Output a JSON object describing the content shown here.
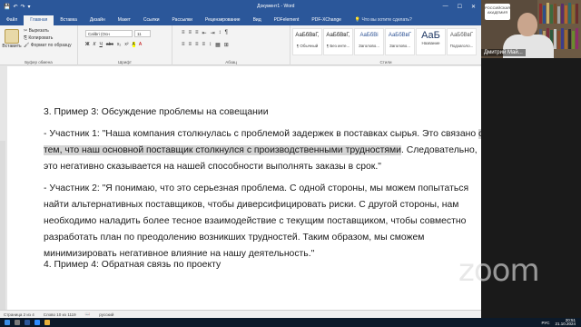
{
  "window": {
    "title": "Документ1 - Word",
    "qat": [
      "💾",
      "↶",
      "↷",
      "▾"
    ],
    "controls": [
      "—",
      "☐",
      "✕"
    ]
  },
  "ribbon_tabs": [
    "Файл",
    "Главная",
    "Вставка",
    "Дизайн",
    "Макет",
    "Ссылки",
    "Рассылки",
    "Рецензирование",
    "Вид",
    "PDFelement",
    "PDF-XChange"
  ],
  "tell_me": "Что вы хотите сделать?",
  "clipboard": {
    "paste_label": "Вставить",
    "cut": "Вырезать",
    "copy": "Копировать",
    "format_painter": "Формат по образцу",
    "group_label": "Буфер обмена"
  },
  "font": {
    "name": "Calibri (Осн",
    "size": "11",
    "format_buttons": [
      "Ж",
      "К",
      "Ч",
      "abc",
      "x₂",
      "x²",
      "A",
      "A"
    ],
    "group_label": "Шрифт"
  },
  "paragraph": {
    "row1": [
      "≡",
      "≡",
      "≡",
      "⇤",
      "⇥",
      "↕",
      "¶"
    ],
    "row2": [
      "≡",
      "≡",
      "≡",
      "≡",
      "↕",
      "▦",
      "⊞"
    ],
    "group_label": "Абзац"
  },
  "styles": {
    "items": [
      {
        "sample": "АаБбВвГ,",
        "name": "¶ Обычный",
        "big": false
      },
      {
        "sample": "АаБбВвГ,",
        "name": "¶ Без инте...",
        "big": false
      },
      {
        "sample": "АаБбВі",
        "name": "Заголово...",
        "big": false
      },
      {
        "sample": "АаБбВвГ",
        "name": "Заголово...",
        "big": false
      },
      {
        "sample": "АаБ",
        "name": "Название",
        "big": true
      },
      {
        "sample": "АаБбВвГ",
        "name": "Подзаголо...",
        "big": false
      }
    ],
    "group_label": "Стили"
  },
  "document": {
    "heading": "3. Пример 3: Обсуждение проблемы на совещании",
    "p1_pre": "   - Участник 1: \"Наша компания столкнулась с проблемой задержек в поставках сырья. Это связано ",
    "p1_sel": "с тем, что наш основной поставщик столкнулся с производственными трудностями",
    "p1_post": ". Следовательно, это негативно сказывается на нашей способности выполнять заказы в срок.\"",
    "p2": "   - Участник 2: \"Я понимаю, что это серьезная проблема. С одной стороны, мы можем попытаться найти альтернативных поставщиков, чтобы диверсифицировать риски. С другой стороны, нам необходимо наладить более тесное взаимодействие с текущим поставщиком, чтобы совместно разработать план по преодолению возникших трудностей. Таким образом, мы сможем минимизировать негативное влияние на нашу деятельность.\"",
    "next_heading": "4. Пример 4: Обратная связь по проекту"
  },
  "status": {
    "page": "Страница 2 из 4",
    "words": "Слово 10 из 1119",
    "lang": "русский"
  },
  "zoom": {
    "participant": "Дмитрий Май...",
    "badge": "РОССИЙСКАЯ АКАДЕМИЯ",
    "wordmark": "zoom"
  },
  "taskbar": {
    "time": "20:51",
    "date": "21.10.2024",
    "lang": "РУС"
  },
  "colors": {
    "word_blue": "#2b579a",
    "selection": "#d4d4d4",
    "taskbar": "#0c1a2a"
  }
}
